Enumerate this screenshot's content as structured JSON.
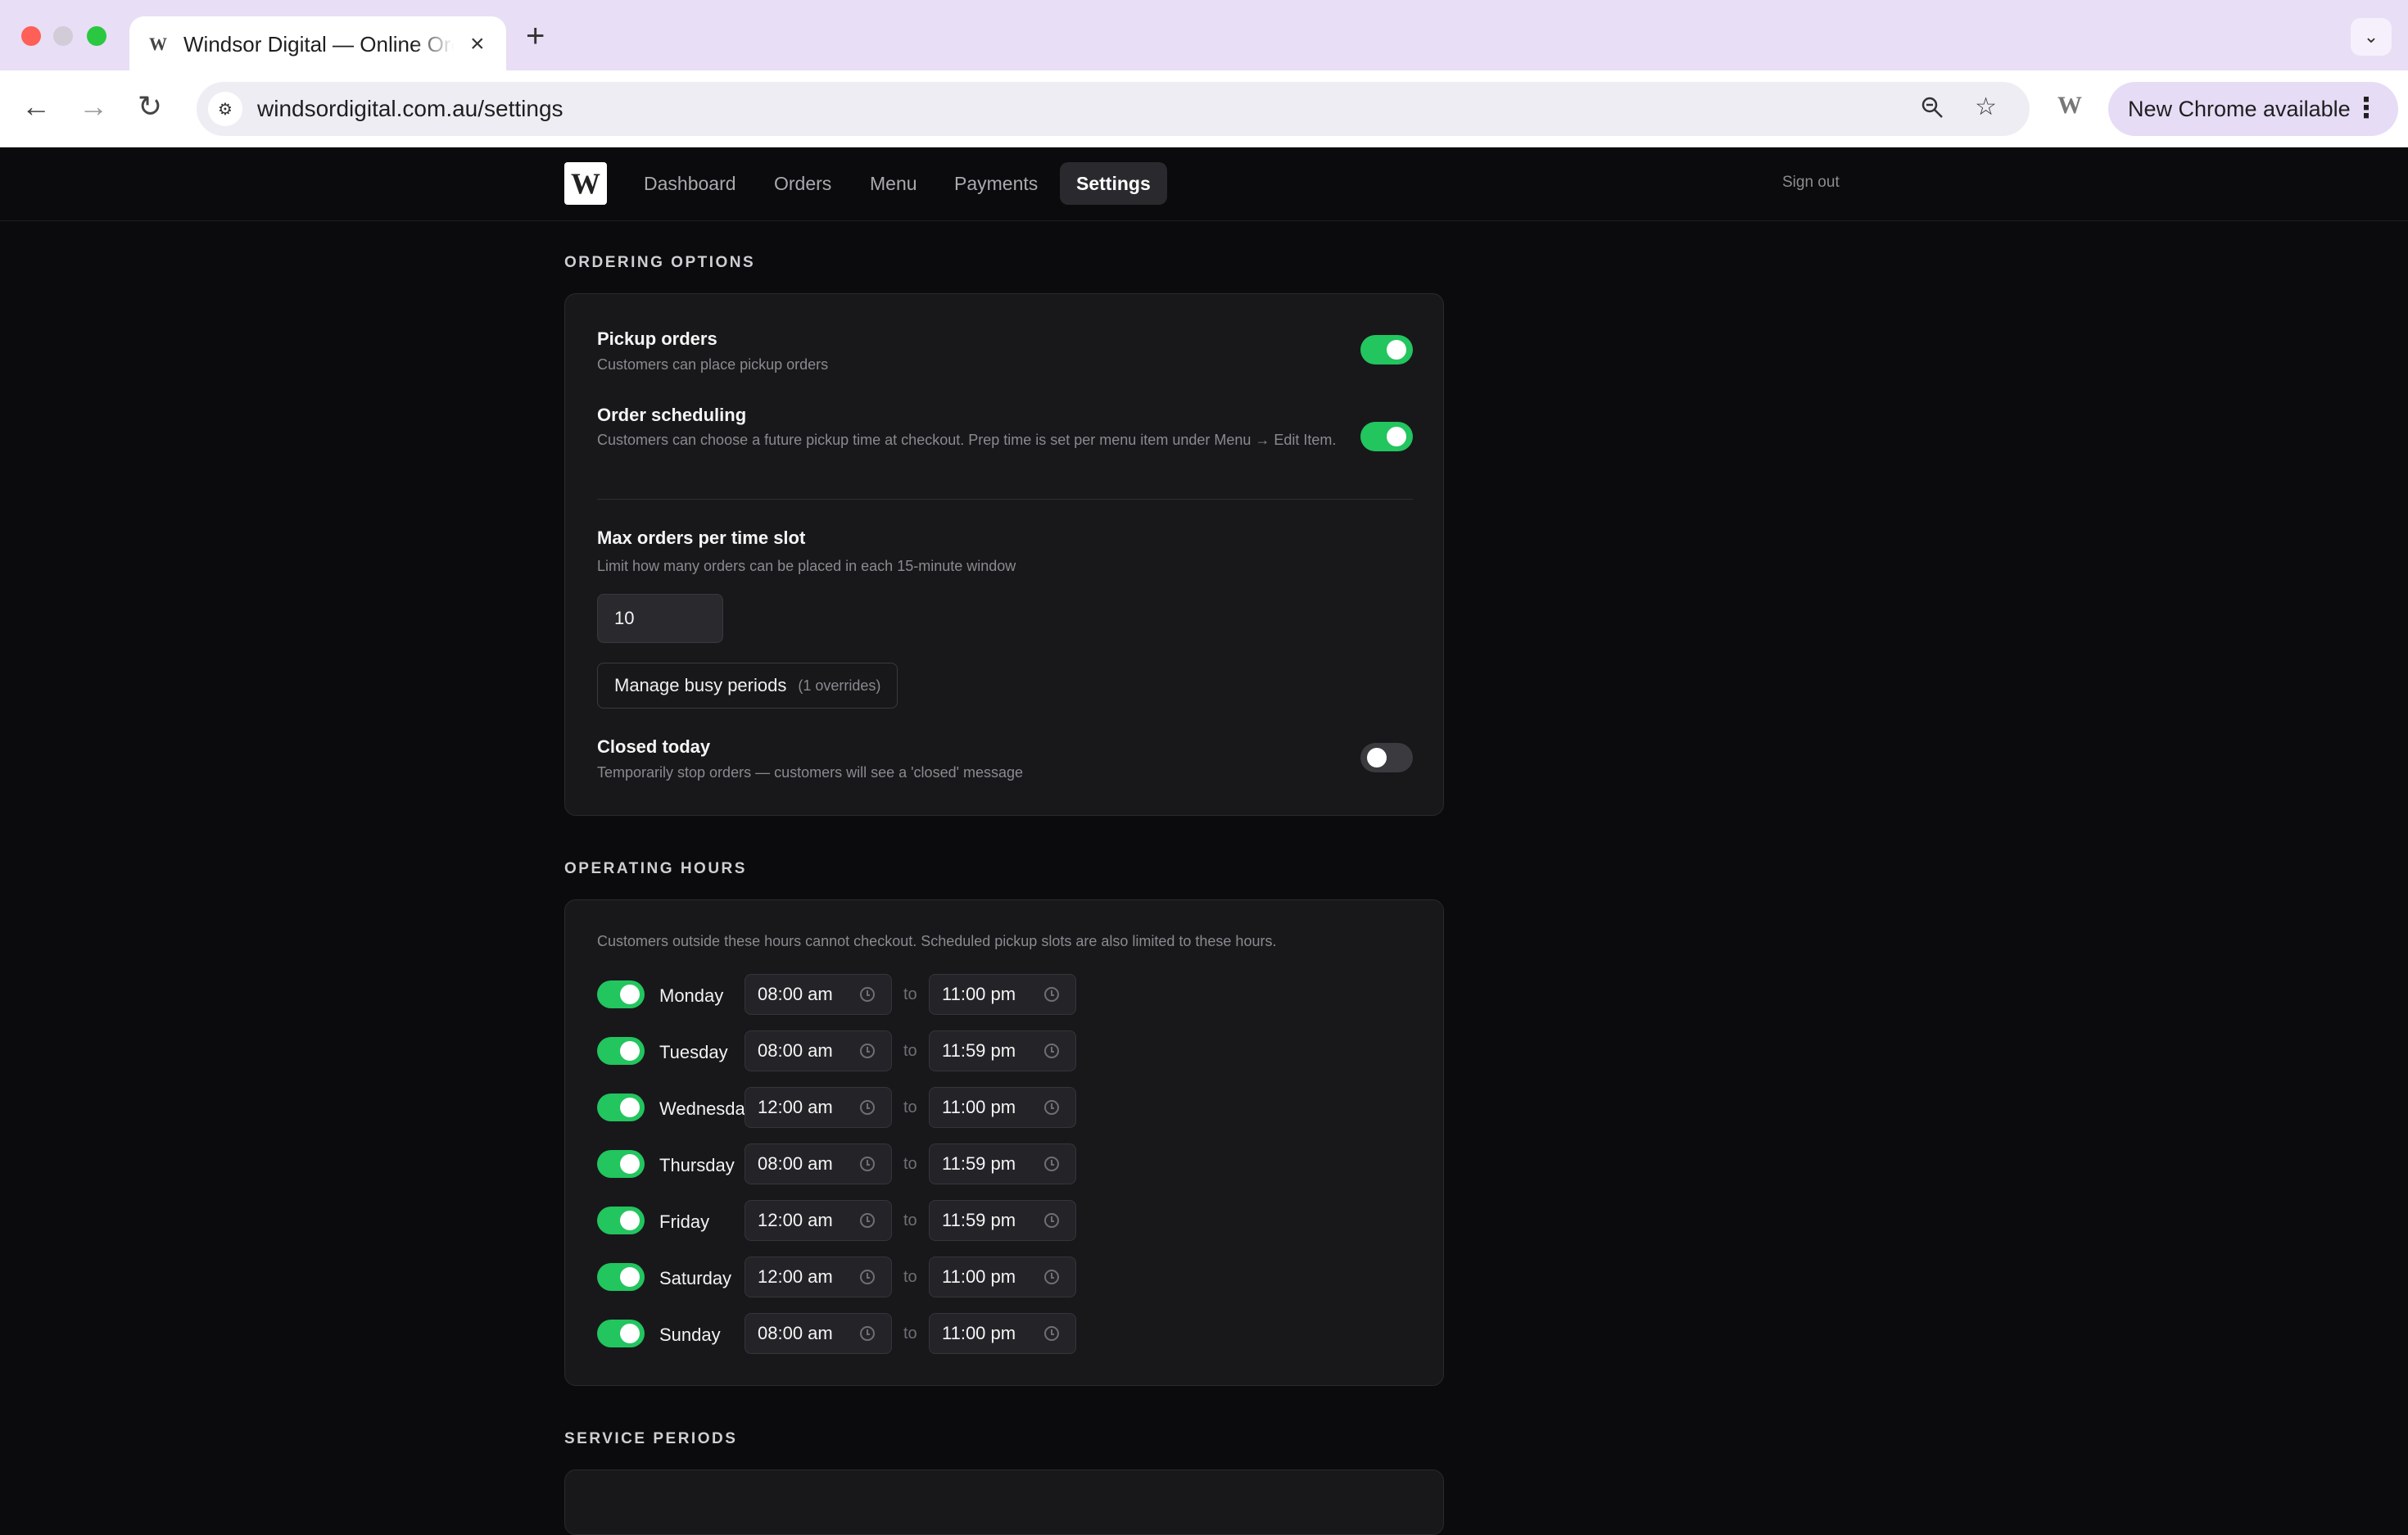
{
  "browser": {
    "tab_title": "Windsor Digital — Online Ordering",
    "favicon": "W",
    "url": "windsordigital.com.au/settings",
    "update_label": "New Chrome available",
    "extension_letter": "W"
  },
  "app": {
    "logo": "W",
    "nav": [
      "Dashboard",
      "Orders",
      "Menu",
      "Payments",
      "Settings"
    ],
    "active_nav": "Settings",
    "sign_out": "Sign out"
  },
  "ordering": {
    "section_title": "ORDERING OPTIONS",
    "pickup": {
      "title": "Pickup orders",
      "desc": "Customers can place pickup orders",
      "enabled": true
    },
    "scheduling": {
      "title": "Order scheduling",
      "desc": "Customers can choose a future pickup time at checkout. Prep time is set per menu item under Menu → Edit Item.",
      "enabled": true
    },
    "max_orders": {
      "title": "Max orders per time slot",
      "desc": "Limit how many orders can be placed in each 15-minute window",
      "value": "10"
    },
    "busy_button": {
      "label": "Manage busy periods",
      "count": "(1 overrides)"
    },
    "closed_today": {
      "title": "Closed today",
      "desc": "Temporarily stop orders — customers will see a 'closed' message",
      "enabled": false
    }
  },
  "hours": {
    "section_title": "OPERATING HOURS",
    "intro": "Customers outside these hours cannot checkout. Scheduled pickup slots are also limited to these hours.",
    "to_word": "to",
    "days": [
      {
        "name": "Monday",
        "from": "08:00 am",
        "to": "11:00 pm",
        "enabled": true
      },
      {
        "name": "Tuesday",
        "from": "08:00 am",
        "to": "11:59 pm",
        "enabled": true
      },
      {
        "name": "Wednesday",
        "from": "12:00 am",
        "to": "11:00 pm",
        "enabled": true
      },
      {
        "name": "Thursday",
        "from": "08:00 am",
        "to": "11:59 pm",
        "enabled": true
      },
      {
        "name": "Friday",
        "from": "12:00 am",
        "to": "11:59 pm",
        "enabled": true
      },
      {
        "name": "Saturday",
        "from": "12:00 am",
        "to": "11:00 pm",
        "enabled": true
      },
      {
        "name": "Sunday",
        "from": "08:00 am",
        "to": "11:00 pm",
        "enabled": true
      }
    ]
  },
  "service": {
    "section_title": "SERVICE PERIODS"
  },
  "colors": {
    "accent_green": "#22c55e",
    "background": "#0b0b0d",
    "card": "#18181b"
  }
}
